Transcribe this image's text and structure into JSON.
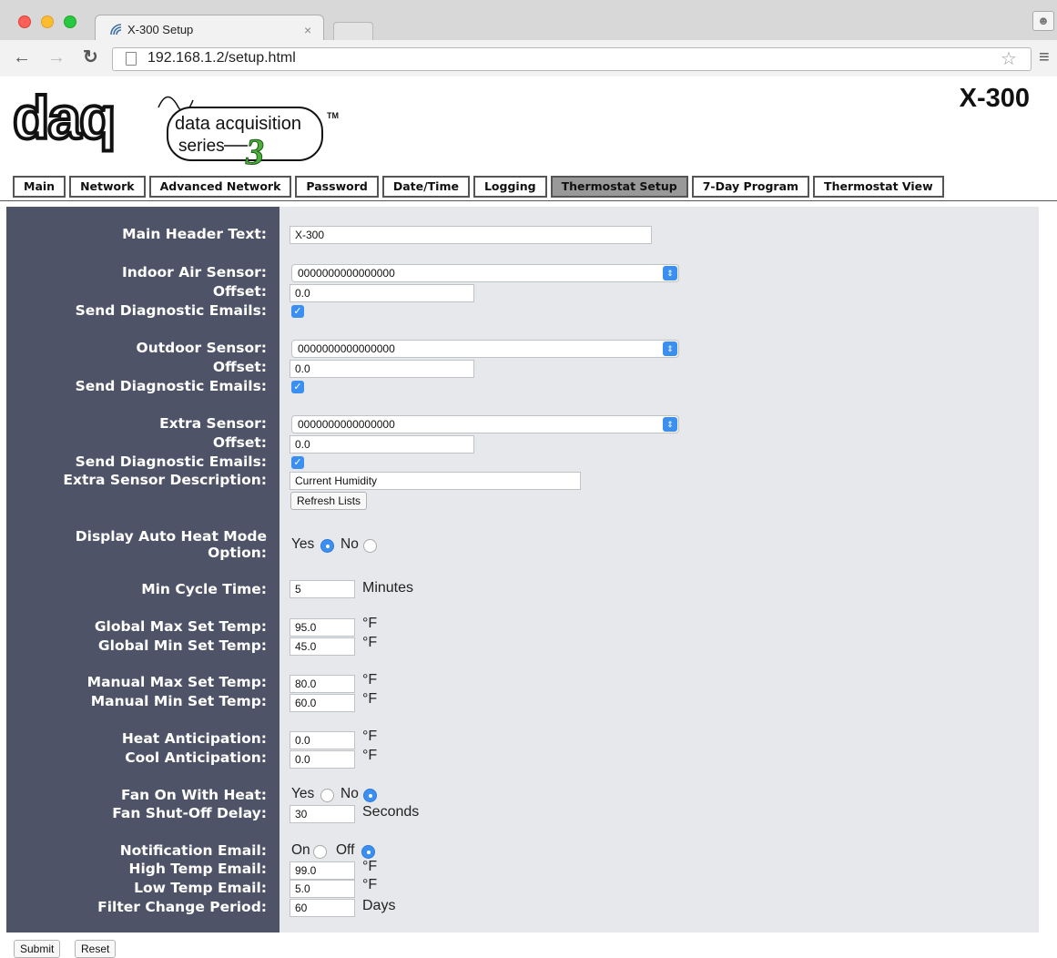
{
  "browser": {
    "tab_title": "X-300 Setup",
    "tab_close": "×",
    "url": "192.168.1.2/setup.html"
  },
  "header": {
    "logo_text": {
      "daq": "daq",
      "line1": "data acquisition",
      "line2": "series",
      "tm": "TM",
      "digit": "3"
    },
    "model": "X-300"
  },
  "nav": {
    "tabs": [
      "Main",
      "Network",
      "Advanced Network",
      "Password",
      "Date/Time",
      "Logging",
      "Thermostat Setup",
      "7-Day Program",
      "Thermostat View"
    ],
    "active": "Thermostat Setup"
  },
  "form": {
    "main_header_label": "Main Header Text:",
    "main_header_value": "X-300",
    "indoor_label": "Indoor Air Sensor:",
    "indoor_value": "0000000000000000",
    "indoor_offset_label": "Offset:",
    "indoor_offset_value": "0.0",
    "indoor_diag_label": "Send Diagnostic Emails:",
    "outdoor_label": "Outdoor Sensor:",
    "outdoor_value": "0000000000000000",
    "outdoor_offset_label": "Offset:",
    "outdoor_offset_value": "0.0",
    "outdoor_diag_label": "Send Diagnostic Emails:",
    "extra_label": "Extra Sensor:",
    "extra_value": "0000000000000000",
    "extra_offset_label": "Offset:",
    "extra_offset_value": "0.0",
    "extra_diag_label": "Send Diagnostic Emails:",
    "extra_desc_label": "Extra Sensor Description:",
    "extra_desc_value": "Current Humidity",
    "refresh_button": "Refresh Lists",
    "auto_heat_label_1": "Display Auto Heat Mode",
    "auto_heat_label_2": "Option:",
    "auto_heat_yes": "Yes",
    "auto_heat_no": "No",
    "auto_heat_selected": "Yes",
    "min_cycle_label": "Min Cycle Time:",
    "min_cycle_value": "5",
    "min_cycle_unit": "Minutes",
    "global_max_label": "Global Max Set Temp:",
    "global_max_value": "95.0",
    "global_min_label": "Global Min Set Temp:",
    "global_min_value": "45.0",
    "manual_max_label": "Manual Max Set Temp:",
    "manual_max_value": "80.0",
    "manual_min_label": "Manual Min Set Temp:",
    "manual_min_value": "60.0",
    "heat_ant_label": "Heat Anticipation:",
    "heat_ant_value": "0.0",
    "cool_ant_label": "Cool Anticipation:",
    "cool_ant_value": "0.0",
    "temp_unit": "°F",
    "fan_heat_label": "Fan On With Heat:",
    "fan_heat_yes": "Yes",
    "fan_heat_no": "No",
    "fan_heat_selected": "No",
    "fan_delay_label": "Fan Shut-Off Delay:",
    "fan_delay_value": "30",
    "fan_delay_unit": "Seconds",
    "notif_label": "Notification Email:",
    "notif_on": "On",
    "notif_off": "Off",
    "notif_selected": "Off",
    "high_temp_label": "High Temp Email:",
    "high_temp_value": "99.0",
    "low_temp_label": "Low Temp Email:",
    "low_temp_value": "5.0",
    "filter_label": "Filter Change Period:",
    "filter_value": "60",
    "filter_unit": "Days"
  },
  "actions": {
    "submit": "Submit",
    "reset": "Reset"
  }
}
